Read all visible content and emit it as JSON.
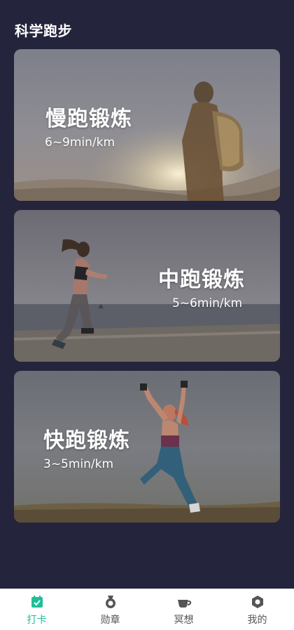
{
  "page": {
    "title": "科学跑步"
  },
  "cards": [
    {
      "title": "慢跑锻炼",
      "pace": "6~9min/km",
      "image": "man-with-backpack-sunset-photo"
    },
    {
      "title": "中跑锻炼",
      "pace": "5~6min/km",
      "image": "woman-running-by-sea-photo"
    },
    {
      "title": "快跑锻炼",
      "pace": "3~5min/km",
      "image": "woman-jumping-in-field-photo"
    }
  ],
  "tabbar": {
    "active_color": "#1fbf96",
    "inactive_color": "#555555",
    "items": [
      {
        "label": "打卡",
        "icon": "calendar-check-icon",
        "active": true
      },
      {
        "label": "勋章",
        "icon": "medal-icon",
        "active": false
      },
      {
        "label": "冥想",
        "icon": "teacup-icon",
        "active": false
      },
      {
        "label": "我的",
        "icon": "profile-hexagon-icon",
        "active": false
      }
    ]
  }
}
